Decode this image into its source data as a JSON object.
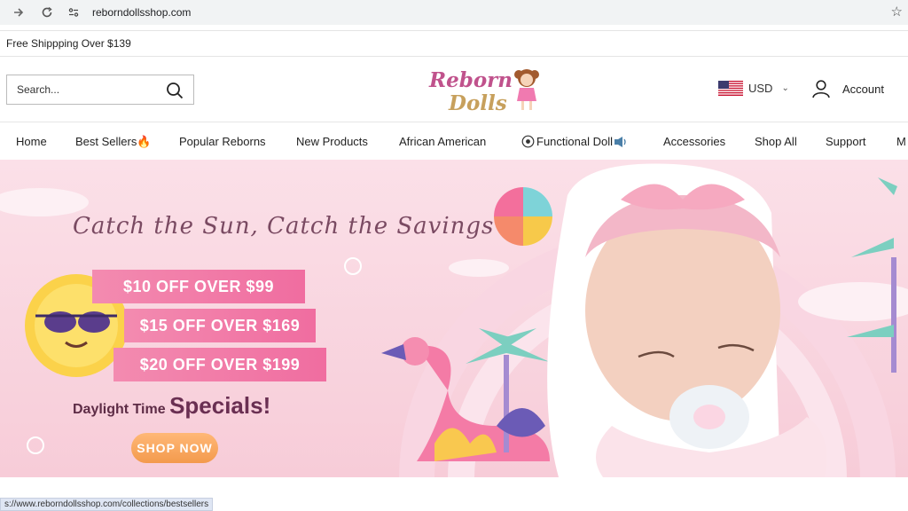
{
  "browser": {
    "url": "reborndollsshop.com",
    "icons": {
      "forward": "arrow-right-icon",
      "reload": "reload-icon",
      "site_info": "site-info-icon",
      "bookmark": "star-icon"
    }
  },
  "announcement": {
    "text": "Free Shippping Over $139"
  },
  "header": {
    "search_placeholder": "Search...",
    "logo_line1": "Reborn",
    "logo_line2": "Dolls",
    "currency": "USD",
    "account_label": "Account"
  },
  "nav": {
    "items": [
      {
        "label": "Home"
      },
      {
        "label": "Best Sellers🔥"
      },
      {
        "label": "Popular Reborns"
      },
      {
        "label": "New Products"
      },
      {
        "label": "African American"
      },
      {
        "label": "Functional Doll"
      },
      {
        "label": "Accessories"
      },
      {
        "label": "Shop All"
      },
      {
        "label": "Support"
      },
      {
        "label": "M"
      }
    ]
  },
  "banner": {
    "headline": "Catch the Sun, Catch the Savings",
    "offers": [
      "$10 OFF OVER $99",
      "$15 OFF OVER $169",
      "$20 OFF OVER $199"
    ],
    "daylight_prefix": "Daylight Time ",
    "daylight_big": "Specials!",
    "cta": "SHOP NOW"
  },
  "status_url": "s://www.reborndollsshop.com/collections/bestsellers",
  "colors": {
    "accent_pink": "#f06da0",
    "banner_bg": "#f7ccd8",
    "cta_orange": "#f39a4d"
  }
}
